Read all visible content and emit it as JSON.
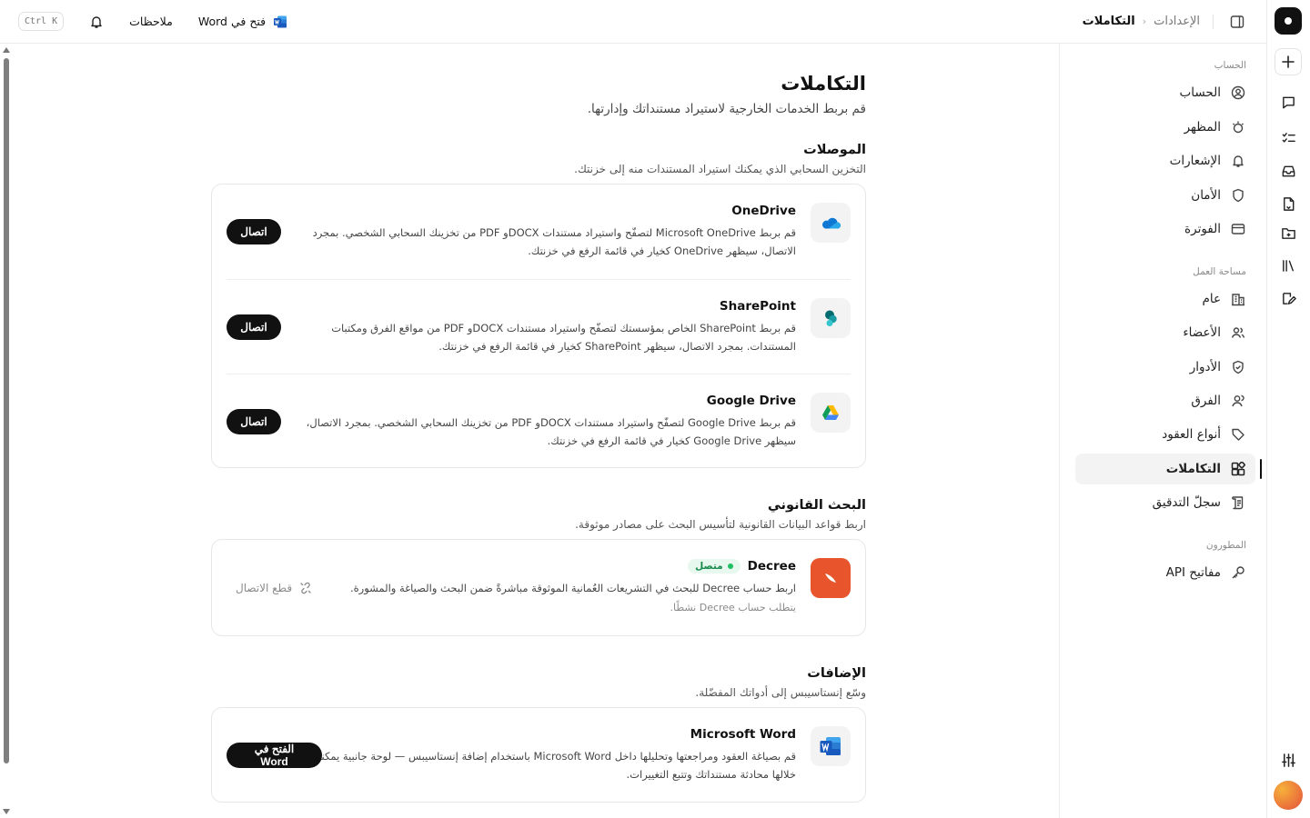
{
  "rail": {
    "icons": [
      "logo-icon",
      "plus-icon",
      "chat-icon",
      "tasks-icon",
      "inbox-icon",
      "document-icon",
      "folder-icon",
      "library-icon",
      "edit-icon",
      "sliders-icon",
      "avatar"
    ]
  },
  "topbar": {
    "breadcrumb_parent": "الإعدادات",
    "breadcrumb_current": "التكاملات",
    "shortcut": "Ctrl K",
    "notes_label": "ملاحظات",
    "open_word_label": "فتح في Word"
  },
  "sidebar": {
    "section_account": "الحساب",
    "section_workspace": "مساحة العمل",
    "section_developers": "المطورون",
    "account_items": [
      {
        "label": "الحساب",
        "icon": "user-circle-icon"
      },
      {
        "label": "المظهر",
        "icon": "appearance-icon"
      },
      {
        "label": "الإشعارات",
        "icon": "bell-icon"
      },
      {
        "label": "الأمان",
        "icon": "shield-icon"
      },
      {
        "label": "الفوترة",
        "icon": "card-icon"
      }
    ],
    "workspace_items": [
      {
        "label": "عام",
        "icon": "building-icon"
      },
      {
        "label": "الأعضاء",
        "icon": "members-icon"
      },
      {
        "label": "الأدوار",
        "icon": "shield-check-icon"
      },
      {
        "label": "الفرق",
        "icon": "team-icon"
      },
      {
        "label": "أنواع العقود",
        "icon": "tag-icon"
      },
      {
        "label": "التكاملات",
        "icon": "integrations-icon",
        "active": true
      },
      {
        "label": "سجلّ التدقيق",
        "icon": "audit-icon"
      }
    ],
    "developer_items": [
      {
        "label": "مفاتيح API",
        "icon": "key-icon"
      }
    ]
  },
  "page": {
    "title": "التكاملات",
    "subtitle": "قم بربط الخدمات الخارجية لاستيراد مستنداتك وإدارتها."
  },
  "connectors": {
    "title": "الموصلات",
    "desc": "التخزين السحابي الذي يمكنك استيراد المستندات منه إلى خزنتك.",
    "items": [
      {
        "name": "OneDrive",
        "icon": "onedrive-icon",
        "desc": "قم بربط Microsoft OneDrive لتصفّح واستيراد مستندات DOCXو PDF من تخزينك السحابي الشخصي. بمجرد الاتصال، سيظهر OneDrive كخيار في قائمة الرفع في خزنتك.",
        "button": "اتصال"
      },
      {
        "name": "SharePoint",
        "icon": "sharepoint-icon",
        "desc": "قم بربط SharePoint الخاص بمؤسستك لتصفّح واستيراد مستندات DOCXو PDF من مواقع الفرق ومكتبات المستندات. بمجرد الاتصال، سيظهر SharePoint كخيار في قائمة الرفع في خزنتك.",
        "button": "اتصال"
      },
      {
        "name": "Google Drive",
        "icon": "google-drive-icon",
        "desc": "قم بربط Google Drive لتصفّح واستيراد مستندات DOCXو PDF من تخزينك السحابي الشخصي. بمجرد الاتصال، سيظهر Google Drive كخيار في قائمة الرفع في خزنتك.",
        "button": "اتصال"
      }
    ]
  },
  "legal": {
    "title": "البحث القانوني",
    "desc": "اربط قواعد البيانات القانونية لتأسيس البحث على مصادر موثوقة.",
    "item": {
      "name": "Decree",
      "status": "متصل",
      "desc": "اربط حساب Decree للبحث في التشريعات العُمانية الموثوقة مباشرةً ضمن البحث والصياغة والمشورة.",
      "note": "يتطلب حساب Decree نشطًا.",
      "disconnect": "قطع الاتصال",
      "brand_color": "#e8542b"
    }
  },
  "addons": {
    "title": "الإضافات",
    "desc": "وسّع إنستاسيبس إلى أدواتك المفضّلة.",
    "item": {
      "name": "Microsoft Word",
      "desc": "قم بصياغة العقود ومراجعتها وتحليلها داخل Microsoft Word باستخدام إضافة إنستاسيبس — لوحة جانبية يمكنك من خلالها محادثة مستنداتك وتتبع التغييرات.",
      "button": "الفتح في Word"
    }
  },
  "colors": {
    "accent": "#111111",
    "word_blue": "#185abd",
    "onedrive_blue": "#0f78d4",
    "connected_green": "#1fbf62"
  }
}
